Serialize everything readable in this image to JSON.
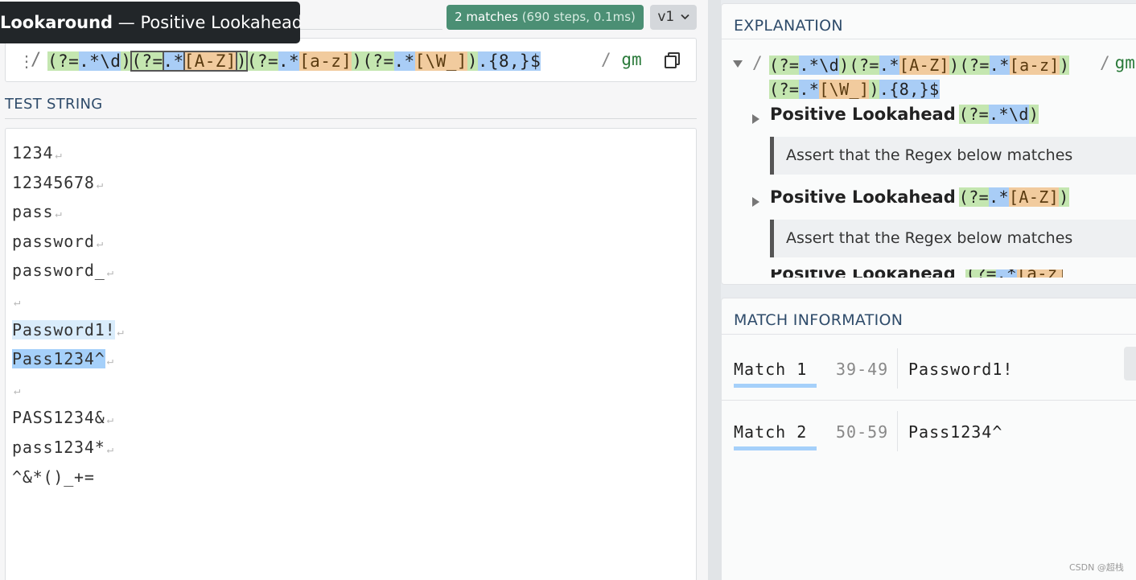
{
  "tooltip": {
    "strong": "Lookaround",
    "rest": " — Positive Lookahead"
  },
  "toolbar": {
    "matches_strong": "2 matches",
    "matches_detail": " (690 steps, 0.1ms)",
    "version": "v1"
  },
  "regex": {
    "open_delim": "/",
    "tokens": [
      {
        "t": "(?=",
        "c": "grp"
      },
      {
        "t": ".*",
        "c": "meta"
      },
      {
        "t": "\\d",
        "c": "meta"
      },
      {
        "t": ")",
        "c": "grp"
      },
      {
        "t": "(?=",
        "c": "grp",
        "o": true
      },
      {
        "t": ".*",
        "c": "meta",
        "o": true
      },
      {
        "t": "[A-Z]",
        "c": "cls",
        "o": true
      },
      {
        "t": ")",
        "c": "grp",
        "o": true
      },
      {
        "t": "(?=",
        "c": "grp"
      },
      {
        "t": ".*",
        "c": "meta"
      },
      {
        "t": "[a-z]",
        "c": "cls"
      },
      {
        "t": ")",
        "c": "grp"
      },
      {
        "t": "(?=",
        "c": "grp"
      },
      {
        "t": ".*",
        "c": "meta"
      },
      {
        "t": "[\\W_]",
        "c": "cls"
      },
      {
        "t": ")",
        "c": "grp"
      },
      {
        "t": ".",
        "c": "meta"
      },
      {
        "t": "{8,}",
        "c": "meta"
      },
      {
        "t": "$",
        "c": "meta"
      }
    ],
    "close_delim": "/",
    "flags": "gm"
  },
  "test_string": {
    "label": "TEST STRING",
    "lines": [
      {
        "text": "1234",
        "hl": ""
      },
      {
        "text": "12345678",
        "hl": ""
      },
      {
        "text": "pass",
        "hl": ""
      },
      {
        "text": "password",
        "hl": ""
      },
      {
        "text": "password_",
        "hl": ""
      },
      {
        "text": "",
        "hl": ""
      },
      {
        "text": "Password1!",
        "hl": "hl1"
      },
      {
        "text": "Pass1234^",
        "hl": "hl2"
      },
      {
        "text": "",
        "hl": ""
      },
      {
        "text": "PASS1234&",
        "hl": ""
      },
      {
        "text": "pass1234*",
        "hl": ""
      },
      {
        "text": "^&*()_+=",
        "hl": "",
        "no_nl": true
      }
    ],
    "newline_glyph": "↵"
  },
  "explanation": {
    "title": "EXPLANATION",
    "root_open": "/",
    "root_line1": [
      {
        "t": "(?=",
        "c": "grp"
      },
      {
        "t": ".*\\d",
        "c": "meta"
      },
      {
        "t": ")",
        "c": "grp"
      },
      {
        "t": "(?=",
        "c": "grp"
      },
      {
        "t": ".*",
        "c": "meta"
      },
      {
        "t": "[A-Z]",
        "c": "cls"
      },
      {
        "t": ")",
        "c": "grp"
      },
      {
        "t": "(?=",
        "c": "grp"
      },
      {
        "t": ".*",
        "c": "meta"
      },
      {
        "t": "[a-z]",
        "c": "cls"
      },
      {
        "t": ")",
        "c": "grp"
      }
    ],
    "root_line2": [
      {
        "t": "(?=",
        "c": "grp"
      },
      {
        "t": ".*",
        "c": "meta"
      },
      {
        "t": "[\\W_]",
        "c": "cls"
      },
      {
        "t": ")",
        "c": "grp"
      },
      {
        "t": ".{8,}$",
        "c": "meta"
      }
    ],
    "root_close": "/",
    "root_flags": "gm",
    "items": [
      {
        "heading": "Positive Lookahead",
        "tokens": [
          {
            "t": "(?=",
            "c": "grp"
          },
          {
            "t": ".*\\d",
            "c": "meta"
          },
          {
            "t": ")",
            "c": "grp"
          }
        ],
        "note": "Assert that the Regex below matches"
      },
      {
        "heading": "Positive Lookahead",
        "tokens": [
          {
            "t": "(?=",
            "c": "grp"
          },
          {
            "t": ".*",
            "c": "meta"
          },
          {
            "t": "[A-Z]",
            "c": "cls"
          },
          {
            "t": ")",
            "c": "grp"
          }
        ],
        "note": "Assert that the Regex below matches"
      }
    ],
    "clipped_heading": "Positive Lookahead",
    "clipped_tokens": [
      {
        "t": "(?=",
        "c": "grp"
      },
      {
        "t": ".*",
        "c": "meta"
      },
      {
        "t": "[a-z]",
        "c": "cls"
      },
      {
        "t": ")",
        "c": "grp"
      }
    ]
  },
  "match_info": {
    "title": "MATCH INFORMATION",
    "matches": [
      {
        "label": "Match 1",
        "range": "39-49",
        "value": "Password1!"
      },
      {
        "label": "Match 2",
        "range": "50-59",
        "value": "Pass1234^"
      }
    ]
  },
  "watermark": "CSDN @超栈"
}
